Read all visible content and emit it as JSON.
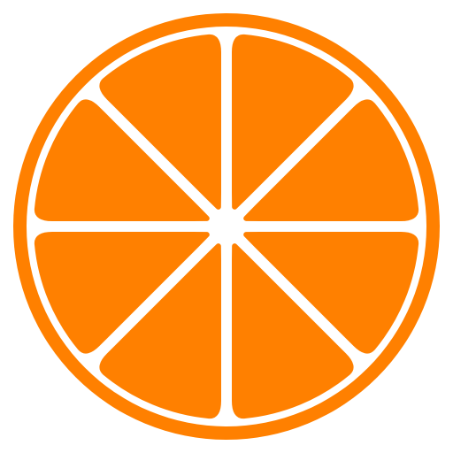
{
  "icon": {
    "name": "orange-slice-icon",
    "segment_count": 8,
    "colors": {
      "background": "#ffffff",
      "rind": "#ff8000",
      "pith": "#ffffff",
      "segment": "#ff8000"
    }
  }
}
